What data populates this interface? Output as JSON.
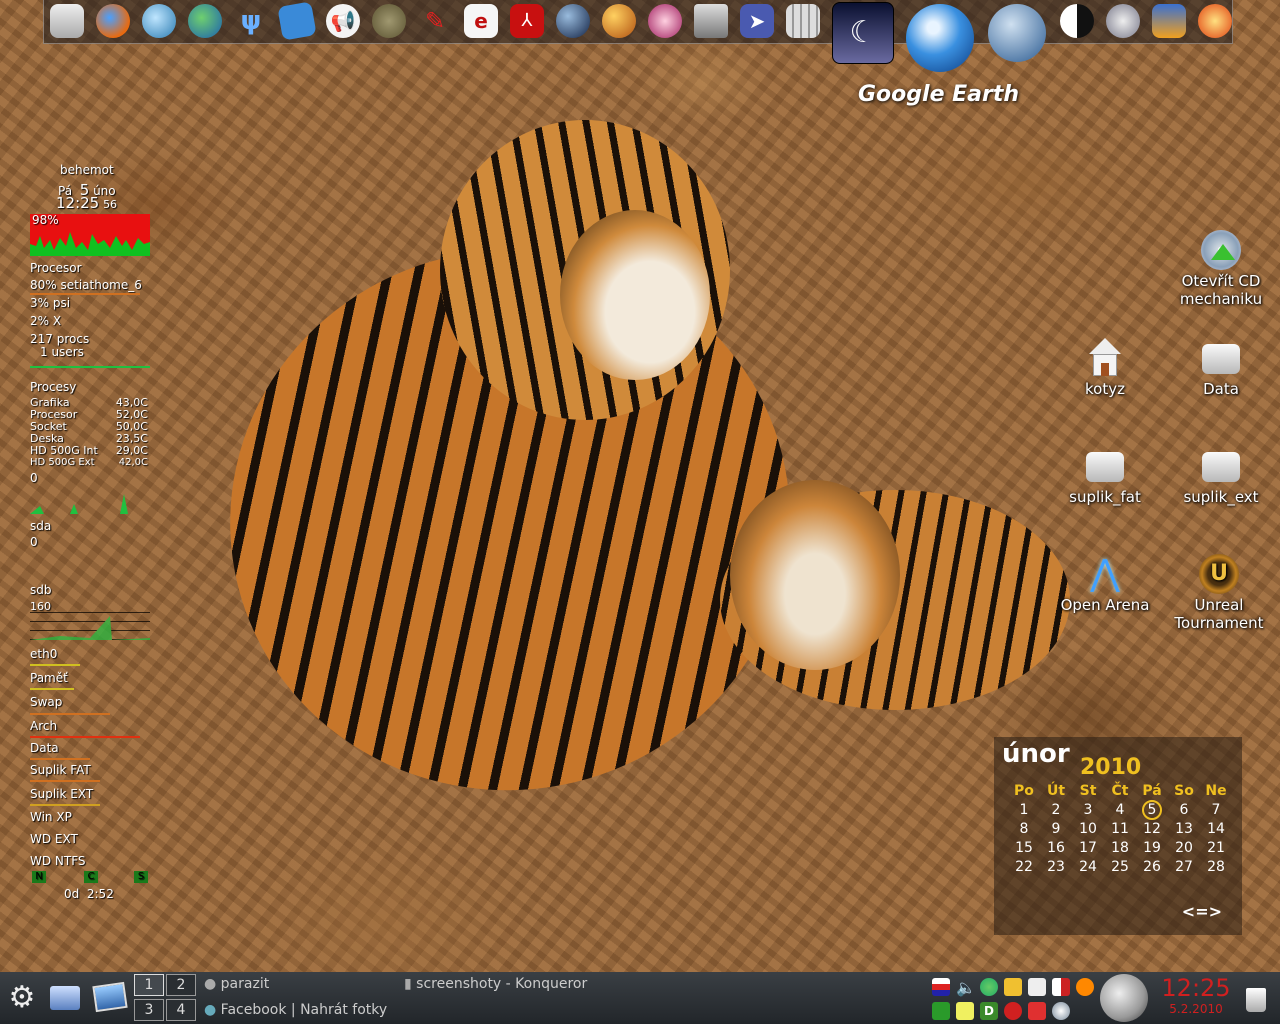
{
  "dock": {
    "icons": [
      "drive-icon",
      "firefox-icon",
      "globe-icon",
      "earth-icon",
      "psi-icon",
      "notes-icon",
      "megaphone-icon",
      "gimp-icon",
      "pen-icon",
      "editor-icon",
      "pdf-icon",
      "ball-icon",
      "orange-ball-icon",
      "bunny-icon",
      "scanner-icon",
      "cursor-app-icon",
      "calculator-icon",
      "moon-app-icon",
      "google-earth-icon",
      "wolf-icon",
      "yin-icon",
      "video-tools-icon",
      "movie-icon",
      "fire-icon"
    ],
    "hover_label": "Google Earth"
  },
  "monitor": {
    "host": "behemot",
    "day": "Pá",
    "date_num": "5",
    "month": "úno",
    "time": "12:25",
    "seconds": "56",
    "cpu_pct": "98%",
    "cpu_label": "Procesor",
    "top_procs": [
      "80% setiathome_6",
      "3% psi",
      "2% X"
    ],
    "procs_count": "217 procs",
    "users": "1 users",
    "procs_label": "Procesy",
    "sensors": [
      {
        "name": "Grafika",
        "value": "43,0C"
      },
      {
        "name": "Procesor",
        "value": "52,0C"
      },
      {
        "name": "Socket",
        "value": "50,0C"
      },
      {
        "name": "Deska",
        "value": "23,5C"
      },
      {
        "name": "HD 500G Int",
        "value": "29,0C"
      },
      {
        "name": "HD 500G Ext",
        "value": "42,0C"
      }
    ],
    "disk_zero": "0",
    "sda": "sda",
    "sda_val": "0",
    "sdb": "sdb",
    "sdb_val": "160",
    "eth": "eth0",
    "mem": "Paměť",
    "swap": "Swap",
    "mounts": [
      "Arch",
      "Data",
      "Suplik FAT",
      "Suplik EXT",
      "Win XP",
      "WD EXT",
      "WD NTFS"
    ],
    "flags": [
      "N",
      "C",
      "S"
    ],
    "uptime": "0d  2:52"
  },
  "desktop_icons": [
    {
      "label": "Otevřít CD mechaniku",
      "icon": "cd-eject-icon"
    },
    {
      "label": "kotyz",
      "icon": "home-icon"
    },
    {
      "label": "Data",
      "icon": "drive-icon"
    },
    {
      "label": "suplik_fat",
      "icon": "drive-icon"
    },
    {
      "label": "suplik_ext",
      "icon": "drive-icon"
    },
    {
      "label": "Open Arena",
      "icon": "open-arena-icon"
    },
    {
      "label": "Unreal Tournament",
      "icon": "unreal-icon"
    }
  ],
  "calendar": {
    "month": "únor",
    "year": "2010",
    "weekdays": [
      "Po",
      "Út",
      "St",
      "Čt",
      "Pá",
      "So",
      "Ne"
    ],
    "weeks": [
      [
        "1",
        "2",
        "3",
        "4",
        "5",
        "6",
        "7"
      ],
      [
        "8",
        "9",
        "10",
        "11",
        "12",
        "13",
        "14"
      ],
      [
        "15",
        "16",
        "17",
        "18",
        "19",
        "20",
        "21"
      ],
      [
        "22",
        "23",
        "24",
        "25",
        "26",
        "27",
        "28"
      ]
    ],
    "today": "5",
    "nav": "<=>"
  },
  "taskbar": {
    "pager": [
      "1",
      "2",
      "3",
      "4"
    ],
    "tasks": [
      "parazit",
      "screenshoty - Konqueror",
      "Facebook | Nahrát fotky"
    ],
    "clock_time": "12:25",
    "clock_date": "5.2.2010"
  },
  "colors": {
    "cpu_graph_bg": "#e81010",
    "cpu_graph_fg": "#10c020",
    "calendar_year": "#f0c020",
    "today_ring": "#f0c020",
    "clock": "#d02020"
  }
}
